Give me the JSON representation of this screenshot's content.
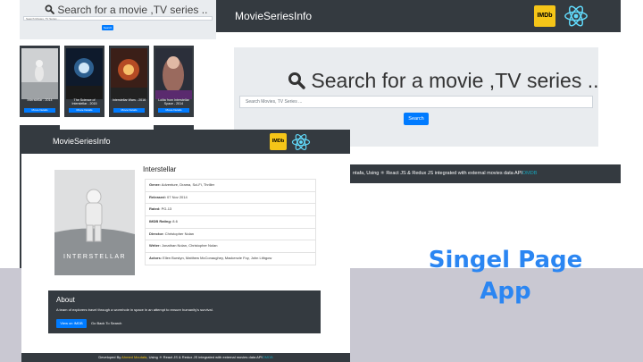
{
  "brand": "MovieSeriesInfo",
  "imdb_logo": "IMDb",
  "search": {
    "title": "Search for a movie ,TV series ..",
    "placeholder": "Search Movies, TV Series ...",
    "button": "Search"
  },
  "results": [
    {
      "title": "Interstellar - 2014",
      "button": "Movie Details"
    },
    {
      "title": "The Science of Interstellar - 2015",
      "button": "Movie Details"
    },
    {
      "title": "Interstellar Wars - 2016",
      "button": "Movie Details"
    },
    {
      "title": "Lolita from Interstellar Space - 2014",
      "button": "Movie Details"
    }
  ],
  "footer": {
    "developer": "Ahmed Moutafa",
    "text_short": "ntafa, Using ⚛ React JS & Redux JS integrated with external movies data API",
    "prefix": "Developed By",
    "middle": ", Using ⚛ React JS & Redux JS integrated with external movies data API",
    "api_link": "OMDB"
  },
  "movie": {
    "title": "Interstellar",
    "poster_text": "INTERSTELLAR",
    "details": [
      {
        "label": "Genre:",
        "value": "Adventure, Drama, Sci-Fi, Thriller"
      },
      {
        "label": "Released:",
        "value": "07 Nov 2014"
      },
      {
        "label": "Rated:",
        "value": "PG-13"
      },
      {
        "label": "IMDB Rating:",
        "value": "8.6"
      },
      {
        "label": "Director:",
        "value": "Christopher Nolan"
      },
      {
        "label": "Writer:",
        "value": "Jonathan Nolan, Christopher Nolan"
      },
      {
        "label": "Actors:",
        "value": "Ellen Burstyn, Matthew McConaughey, Mackenzie Foy, John Lithgow"
      }
    ],
    "about_title": "About",
    "plot": "A team of explorers travel through a wormhole in space in an attempt to ensure humanity's survival.",
    "imdb_button": "View on IMDB",
    "back_link": "Go Back To Search"
  },
  "caption": [
    "Singel Page",
    "App"
  ],
  "colors": {
    "dark": "#343a40",
    "accent": "#007bff",
    "imdb": "#f5c518",
    "react": "#61dafb",
    "caption": "#2b86f2"
  }
}
